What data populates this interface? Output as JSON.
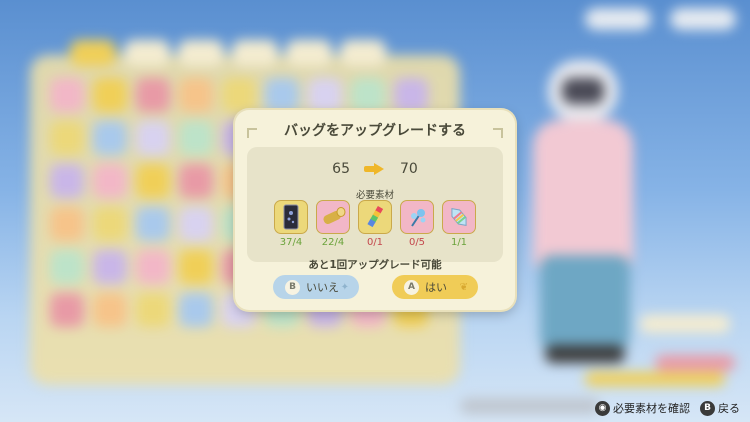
{
  "dialog": {
    "title": "バッグをアップグレードする",
    "level_from": "65",
    "level_to": "70",
    "materials_label": "必要素材",
    "materials": [
      {
        "name": "dark-card",
        "count": "37/4",
        "status": "enough",
        "slot_color": "#ecd87a"
      },
      {
        "name": "wood-log",
        "count": "22/4",
        "status": "enough",
        "slot_color": "#f2b7c7"
      },
      {
        "name": "rainbow-feather",
        "count": "0/1",
        "status": "missing",
        "slot_color": "#ecd87a"
      },
      {
        "name": "blue-flower",
        "count": "0/5",
        "status": "missing",
        "slot_color": "#f2b7c7"
      },
      {
        "name": "rainbow-crystal",
        "count": "1/1",
        "status": "enough",
        "slot_color": "#f2b7c7"
      }
    ],
    "remaining": "あと1回アップグレード可能",
    "no_button": {
      "key": "B",
      "label": "いいえ"
    },
    "yes_button": {
      "key": "A",
      "label": "はい"
    }
  },
  "hints": [
    {
      "key": "◉",
      "label": "必要素材を確認"
    },
    {
      "key": "B",
      "label": "戻る"
    }
  ],
  "colors": {
    "enough": "#6aa23a",
    "missing": "#c4484d",
    "accent_yellow": "#f0cc57",
    "accent_blue": "#b7d4e9"
  }
}
